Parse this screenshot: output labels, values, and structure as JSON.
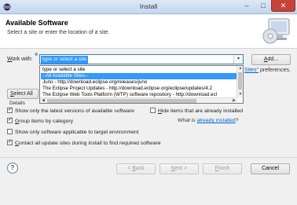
{
  "window": {
    "title": "Install",
    "min_glyph": "–",
    "max_glyph": "□",
    "close_glyph": "✕"
  },
  "banner": {
    "heading": "Available Software",
    "subtitle": "Select a site or enter the location of a site."
  },
  "work_with": {
    "label_access": "W",
    "label_rest": "ork with:",
    "value": "type or select a site",
    "arrow": "▾",
    "add_access": "A",
    "add_rest": "dd..."
  },
  "dropdown": {
    "items": [
      "type or select a site",
      "--All Available Sites--",
      "Juno - http://download.eclipse.org/releases/juno",
      "The Eclipse Project Updates - http://download.eclipse.org/eclipse/updates/4.2",
      "The Eclipse Web Tools Platform (WTP) software repository - http://download.ecl"
    ],
    "selected_index": 1
  },
  "sites_link": {
    "link_text": "Sites\"",
    "suffix": " preferences."
  },
  "select_all": {
    "access": "S",
    "rest": "elect All"
  },
  "details_label": "Details",
  "options": {
    "show_latest": {
      "label": "Show only the latest versions of available software",
      "checked": true
    },
    "group_by_category": {
      "access": "G",
      "rest": "roup items by category",
      "checked": true
    },
    "show_applicable": {
      "label": "Show only software applicable to target environment",
      "checked": false
    },
    "contact_sites": {
      "access": "C",
      "rest": "ontact all update sites during install to find required software",
      "checked": true
    },
    "hide_installed": {
      "access": "H",
      "rest": "ide items that are already installed",
      "checked": false
    }
  },
  "installed": {
    "prefix": "What is ",
    "link": "already installed",
    "suffix": "?"
  },
  "footer": {
    "help": "?",
    "back_prefix": "< ",
    "back_access": "B",
    "back_rest": "ack",
    "next_access": "N",
    "next_rest": "ext >",
    "finish_access": "F",
    "finish_rest": "inish",
    "cancel": "Cancel"
  }
}
